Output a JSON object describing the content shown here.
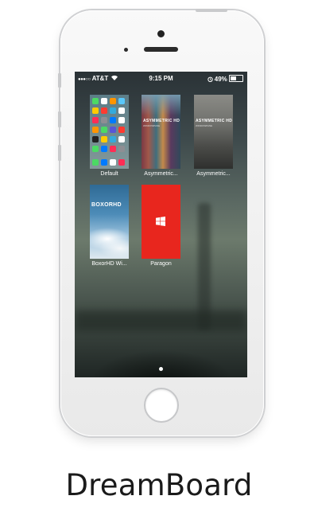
{
  "status_bar": {
    "signal": "●●●○○",
    "carrier": "AT&T",
    "wifi_icon": "wifi-icon",
    "time": "9:15 PM",
    "alarm_icon": "alarm-icon",
    "battery_percent": "49%",
    "battery_level": 0.49
  },
  "themes": [
    {
      "label": "Default"
    },
    {
      "label": "Asymmetric...",
      "thumb_title": "ASYMMETRIC HD",
      "thumb_sub": "WINDOWPANE"
    },
    {
      "label": "Asymmetric...",
      "thumb_title": "ASYMMETRIC HD",
      "thumb_sub": "WINDOWPANE"
    },
    {
      "label": "BoxorHD Wi...",
      "thumb_title": "BOXORHD"
    },
    {
      "label": "Paragon",
      "icon": "windows-logo-icon",
      "accent": "#e8261e"
    }
  ],
  "page_indicator": {
    "count": 1,
    "current": 1
  },
  "caption": "DreamBoard"
}
